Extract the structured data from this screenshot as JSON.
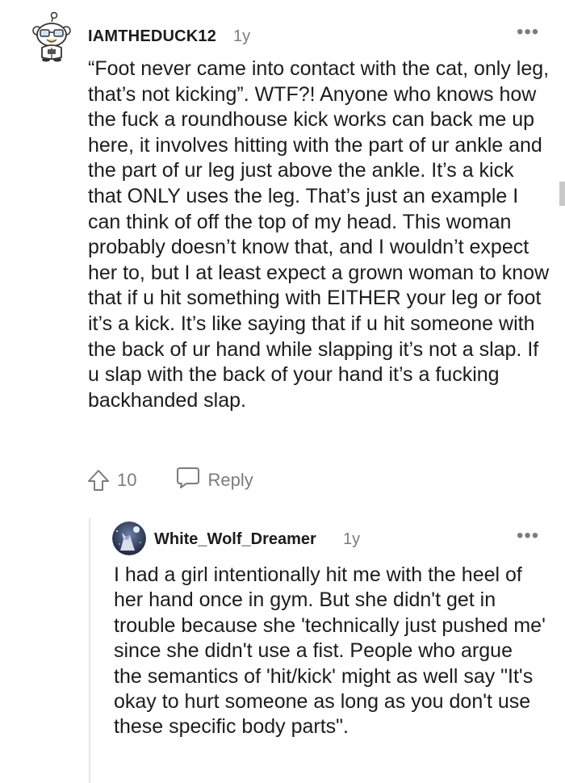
{
  "comment": {
    "username": "IAMTHEDUCK12",
    "time": "1y",
    "more": "•••",
    "body": "“Foot never came into contact with the cat, only leg, that’s not kicking”. WTF?! Anyone who knows how the fuck a roundhouse kick works can back me up here, it involves hitting with the part of ur ankle and the part of ur leg just above the ankle. It’s a kick that ONLY uses the leg. That’s just an example I can think of off the top of my head. This woman probably doesn’t know that, and I wouldn’t expect her to, but I at least expect a grown woman to know that if u hit something with EITHER your leg or foot it’s a kick. It’s like saying that if u hit someone with the back of ur hand while slapping it’s not a slap. If u slap with the back of your hand it’s a fucking backhanded slap.",
    "votes": "10",
    "reply_label": "Reply"
  },
  "reply": {
    "username": "White_Wolf_Dreamer",
    "time": "1y",
    "more": "•••",
    "body": "I had a girl intentionally hit me with the heel of her hand once in gym. But she didn't get in trouble because she 'technically just pushed me' since she didn't use a fist. People who argue the semantics of 'hit/kick' might as well say \"It's okay to hurt someone as long as you don't use these specific body parts\"."
  },
  "colors": {
    "text": "#1c1c1c",
    "meta": "#7c7c7c",
    "thread_line": "#e6e6e6"
  },
  "icons": {
    "upvote": "upvote-arrow-icon",
    "reply": "speech-bubble-icon",
    "more": "more-options-icon"
  }
}
